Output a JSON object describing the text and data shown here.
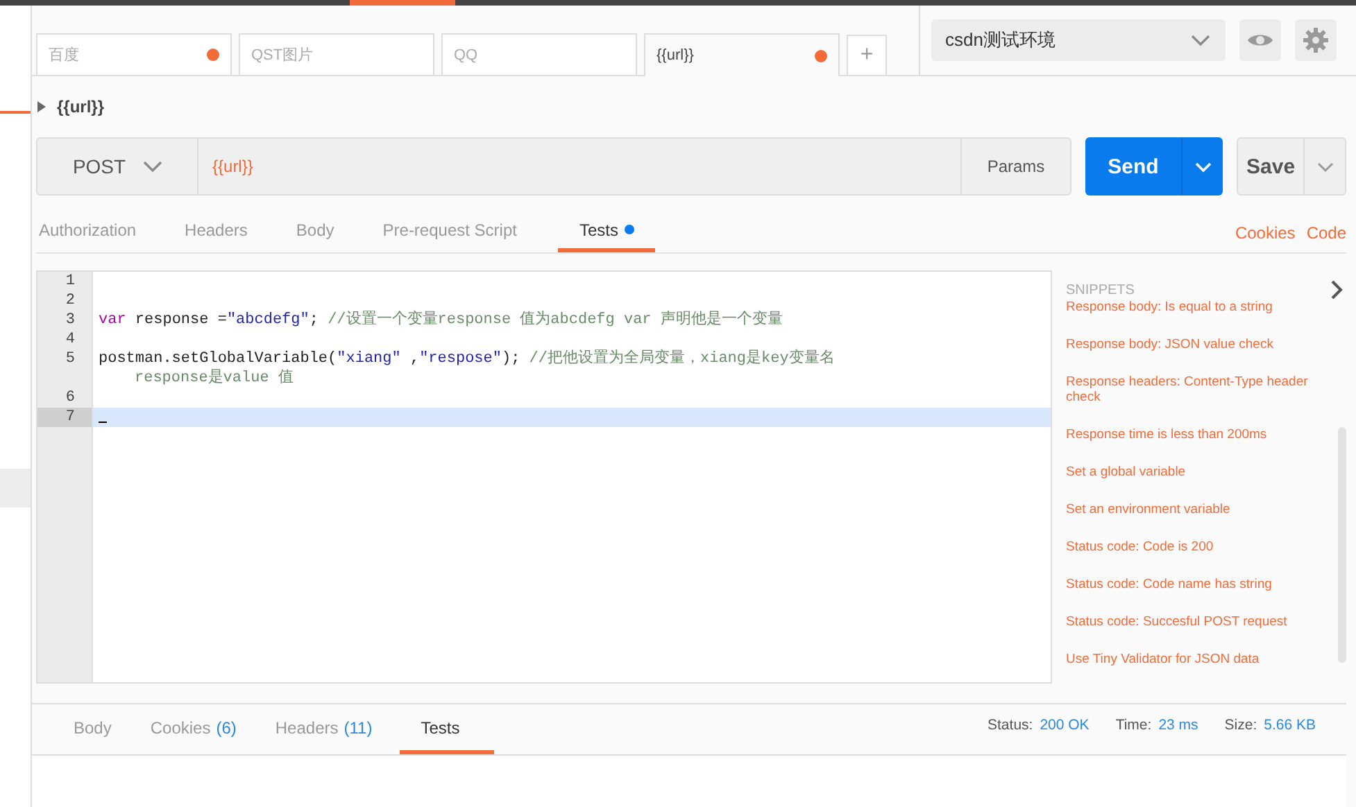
{
  "tabs": [
    {
      "label": "百度",
      "unsaved": true,
      "selected": false
    },
    {
      "label": "QST图片",
      "unsaved": false,
      "selected": false
    },
    {
      "label": "QQ",
      "unsaved": false,
      "selected": false
    },
    {
      "label": "{{url}}",
      "unsaved": true,
      "selected": true
    }
  ],
  "new_tab_button": "+",
  "environment": {
    "value": "csdn测试环境"
  },
  "request_name": "{{url}}",
  "request": {
    "method": "POST",
    "url": "{{url}}",
    "params_button": "Params",
    "send_button": "Send",
    "save_button": "Save"
  },
  "request_tabs": [
    {
      "label": "Authorization",
      "selected": false,
      "dot": false
    },
    {
      "label": "Headers",
      "selected": false,
      "dot": false
    },
    {
      "label": "Body",
      "selected": false,
      "dot": false
    },
    {
      "label": "Pre-request Script",
      "selected": false,
      "dot": false
    },
    {
      "label": "Tests",
      "selected": true,
      "dot": true
    }
  ],
  "links": [
    "Cookies",
    "Code"
  ],
  "editor": {
    "lines": [
      {
        "number": "1",
        "active": false
      },
      {
        "number": "2",
        "active": false
      },
      {
        "number": "3",
        "active": false,
        "segments": [
          {
            "kind": "keyword",
            "text": "var"
          },
          {
            "kind": "plain",
            "text": " response ="
          },
          {
            "kind": "string",
            "text": "\"abcdefg\""
          },
          {
            "kind": "plain",
            "text": "; "
          },
          {
            "kind": "comment",
            "text": "//设置一个变量response 值为abcdefg   var 声明他是一个变量"
          }
        ]
      },
      {
        "number": "4",
        "active": false
      },
      {
        "number": "5",
        "active": false,
        "segments": [
          {
            "kind": "plain",
            "text": "postman.setGlobalVariable("
          },
          {
            "kind": "string",
            "text": "\"xiang\""
          },
          {
            "kind": "plain",
            "text": " ,"
          },
          {
            "kind": "string",
            "text": "\"respose\""
          },
          {
            "kind": "plain",
            "text": ");   "
          },
          {
            "kind": "comment",
            "text": "//把他设置为全局变量，xiang是key变量名"
          }
        ],
        "wrapped": [
          {
            "kind": "comment",
            "text": "response是value 值"
          }
        ]
      },
      {
        "number": "6",
        "active": false
      },
      {
        "number": "7",
        "active": true
      }
    ]
  },
  "snippets": {
    "title": "SNIPPETS",
    "items": [
      "Response body: Is equal to a string",
      "Response body: JSON value check",
      "Response headers: Content-Type header check",
      "Response time is less than 200ms",
      "Set a global variable",
      "Set an environment variable",
      "Status code: Code is 200",
      "Status code: Code name has string",
      "Status code: Succesful POST request",
      "Use Tiny Validator for JSON data"
    ]
  },
  "response_tabs": [
    {
      "label": "Body",
      "selected": false
    },
    {
      "label": "Cookies",
      "count": "(6)",
      "selected": false
    },
    {
      "label": "Headers",
      "count": "(11)",
      "selected": false
    },
    {
      "label": "Tests",
      "selected": true
    }
  ],
  "response_meta": [
    {
      "label": "Status:",
      "value": "200 OK"
    },
    {
      "label": "Time:",
      "value": "23 ms"
    },
    {
      "label": "Size:",
      "value": "5.66 KB"
    }
  ]
}
